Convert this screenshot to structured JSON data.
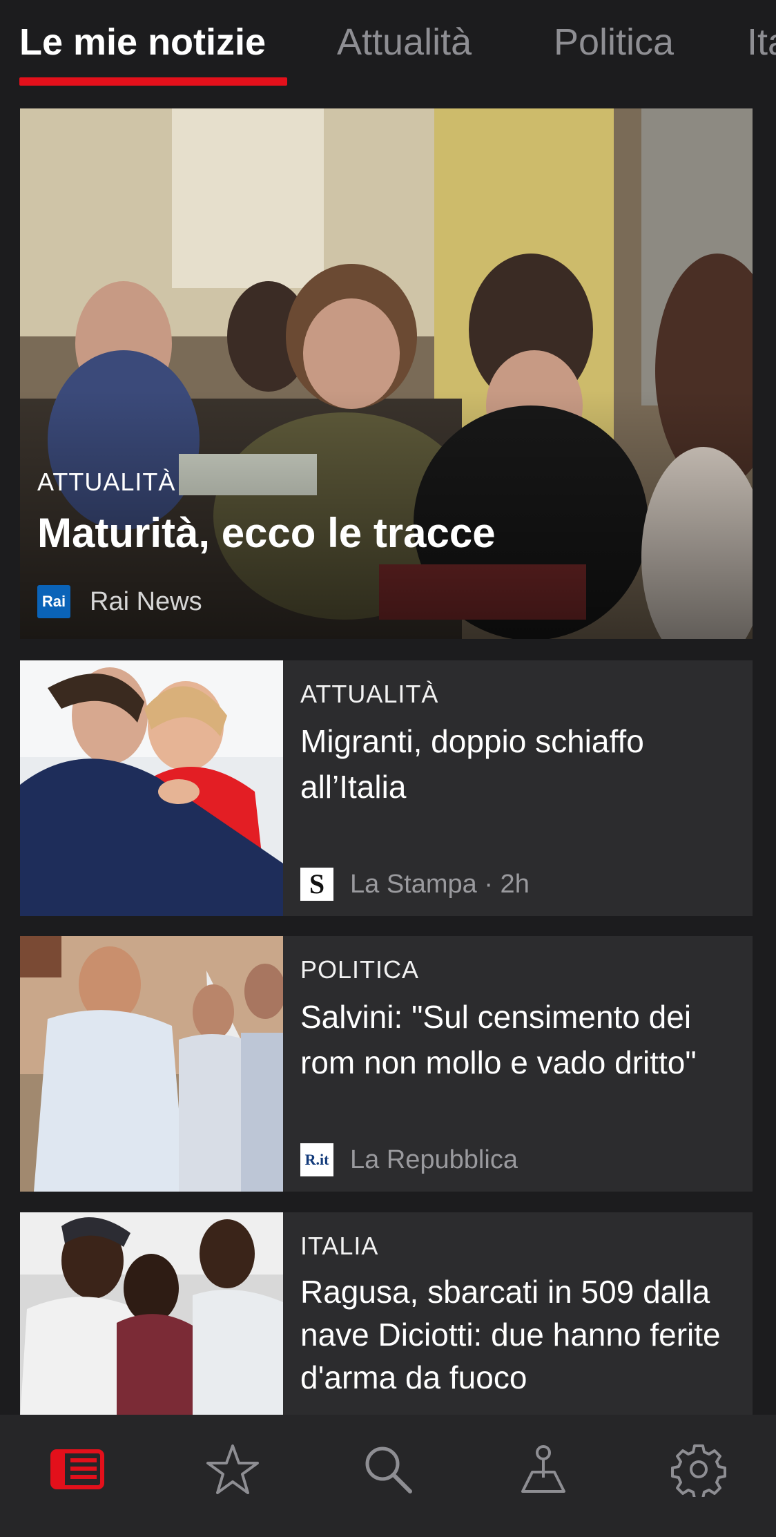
{
  "tabs": [
    {
      "label": "Le mie notizie",
      "active": true
    },
    {
      "label": "Attualità",
      "active": false
    },
    {
      "label": "Politica",
      "active": false
    },
    {
      "label": "Ita",
      "active": false
    }
  ],
  "hero": {
    "category": "ATTUALITÀ",
    "title": "Maturità, ecco le tracce",
    "source_logo_text": "Rai",
    "source": "Rai News"
  },
  "articles": [
    {
      "category": "ATTUALITÀ",
      "title": "Migranti, doppio schiaffo all’Italia",
      "source_logo_text": "S",
      "source": "La Stampa · 2h"
    },
    {
      "category": "POLITICA",
      "title": "Salvini: \"Sul censimento dei rom non mollo e vado dritto\"",
      "source_logo_text": "R.it",
      "source": "La Repubblica"
    },
    {
      "category": "ITALIA",
      "title": "Ragusa, sbarcati in 509 dalla nave Diciotti: due hanno ferite d'arma da fuoco",
      "source_logo_text": "",
      "source": ""
    }
  ],
  "bottom_nav": [
    {
      "icon": "news-icon",
      "active": true
    },
    {
      "icon": "star-icon",
      "active": false
    },
    {
      "icon": "search-icon",
      "active": false
    },
    {
      "icon": "local-pin-icon",
      "active": false
    },
    {
      "icon": "gear-icon",
      "active": false
    }
  ],
  "colors": {
    "accent": "#e3101b",
    "background": "#1c1c1e",
    "card": "#2c2c2e",
    "rai_blue": "#0a63b8"
  }
}
